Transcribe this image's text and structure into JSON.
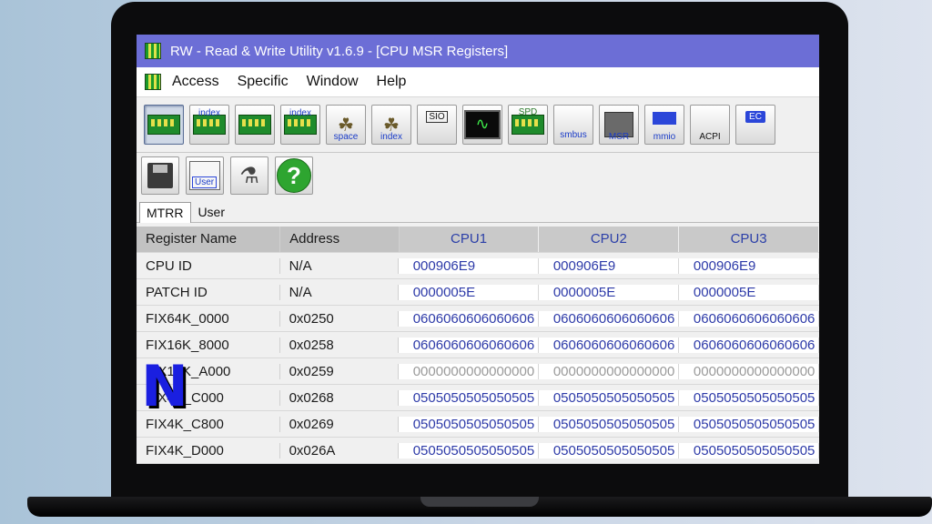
{
  "window": {
    "title": "RW - Read & Write Utility v1.6.9 - [CPU MSR Registers]"
  },
  "menu": [
    "Access",
    "Specific",
    "Window",
    "Help"
  ],
  "toolbar_main": [
    {
      "icon": "pci-board-icon",
      "label": ""
    },
    {
      "icon": "index-board-icon",
      "label": "index"
    },
    {
      "icon": "memory-board-icon",
      "label": ""
    },
    {
      "icon": "index-memory-icon",
      "label": "index"
    },
    {
      "icon": "io-space-icon",
      "label": "space"
    },
    {
      "icon": "io-index-icon",
      "label": "index"
    },
    {
      "icon": "sio-icon",
      "label": "SIO"
    },
    {
      "icon": "oscilloscope-icon",
      "label": ""
    },
    {
      "icon": "spd-icon",
      "label": "SPD"
    },
    {
      "icon": "smbus-icon",
      "label": "smbus"
    },
    {
      "icon": "msr-icon",
      "label": "MSR"
    },
    {
      "icon": "mmio-icon",
      "label": "mmio"
    },
    {
      "icon": "acpi-icon",
      "label": "ACPI"
    },
    {
      "icon": "ec-icon",
      "label": "EC"
    }
  ],
  "toolbar_secondary": [
    {
      "icon": "save-icon",
      "label": ""
    },
    {
      "icon": "user-icon",
      "label": "User"
    },
    {
      "icon": "microscope-icon",
      "label": ""
    },
    {
      "icon": "help-icon",
      "label": "?"
    }
  ],
  "tabs": [
    "MTRR",
    "User"
  ],
  "table": {
    "columns": [
      "Register Name",
      "Address",
      "CPU1",
      "CPU2",
      "CPU3"
    ],
    "rows": [
      {
        "name": "CPU ID",
        "address": "N/A",
        "cpu1": "000906E9",
        "cpu2": "000906E9",
        "cpu3": "000906E9",
        "dim": false
      },
      {
        "name": "PATCH ID",
        "address": "N/A",
        "cpu1": "0000005E",
        "cpu2": "0000005E",
        "cpu3": "0000005E",
        "dim": false
      },
      {
        "name": "FIX64K_0000",
        "address": "0x0250",
        "cpu1": "0606060606060606",
        "cpu2": "0606060606060606",
        "cpu3": "0606060606060606",
        "dim": false
      },
      {
        "name": "FIX16K_8000",
        "address": "0x0258",
        "cpu1": "0606060606060606",
        "cpu2": "0606060606060606",
        "cpu3": "0606060606060606",
        "dim": false
      },
      {
        "name": "FIX16K_A000",
        "address": "0x0259",
        "cpu1": "0000000000000000",
        "cpu2": "0000000000000000",
        "cpu3": "0000000000000000",
        "dim": true
      },
      {
        "name": "FIX4K_C000",
        "address": "0x0268",
        "cpu1": "0505050505050505",
        "cpu2": "0505050505050505",
        "cpu3": "0505050505050505",
        "dim": false
      },
      {
        "name": "FIX4K_C800",
        "address": "0x0269",
        "cpu1": "0505050505050505",
        "cpu2": "0505050505050505",
        "cpu3": "0505050505050505",
        "dim": false
      },
      {
        "name": "FIX4K_D000",
        "address": "0x026A",
        "cpu1": "0505050505050505",
        "cpu2": "0505050505050505",
        "cpu3": "0505050505050505",
        "dim": false
      }
    ]
  },
  "watermark": "N",
  "colors": {
    "titlebar": "#6c6ed6",
    "value_text": "#2d3aa8",
    "dim_value_text": "#9a9a9a",
    "background": "#a9c3d8"
  }
}
